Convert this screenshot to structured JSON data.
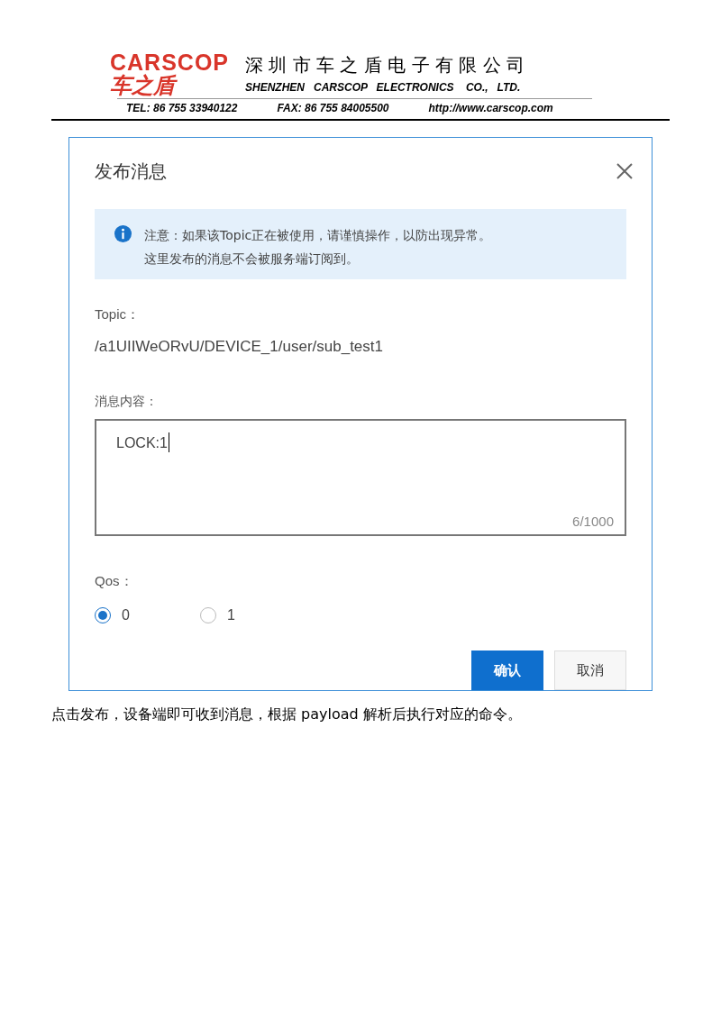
{
  "header": {
    "logo_latin": "CARSCOP",
    "logo_chinese": "车之盾",
    "company_chinese": "深 圳 市 车 之 盾 电 子 有 限 公 司",
    "company_english": "SHENZHEN   CARSCOP   ELECTRONICS    CO.,   LTD.",
    "contacts": [
      "TEL: 86 755 33940122",
      "FAX: 86 755 84005500",
      "http://www.carscop.com"
    ]
  },
  "dialog": {
    "title": "发布消息",
    "notice": [
      "注意：如果该Topic正在被使用，请谨慎操作，以防出现异常。",
      "这里发布的消息不会被服务端订阅到。"
    ],
    "topic_label": "Topic：",
    "topic": "/a1UIIWeORvU/DEVICE_1/user/sub_test1",
    "message_label": "消息内容：",
    "message": {
      "value": "LOCK:1",
      "counter": "6/1000"
    },
    "qos_label": "Qos：",
    "qos_options": [
      {
        "label": "0",
        "selected": true
      },
      {
        "label": "1",
        "selected": false
      }
    ],
    "buttons": [
      {
        "label": "确认",
        "kind": "primary"
      },
      {
        "label": "取消",
        "kind": "secondary"
      }
    ]
  },
  "caption": "点击发布，设备端即可收到消息，根据 payload 解析后执行对应的命令。"
}
